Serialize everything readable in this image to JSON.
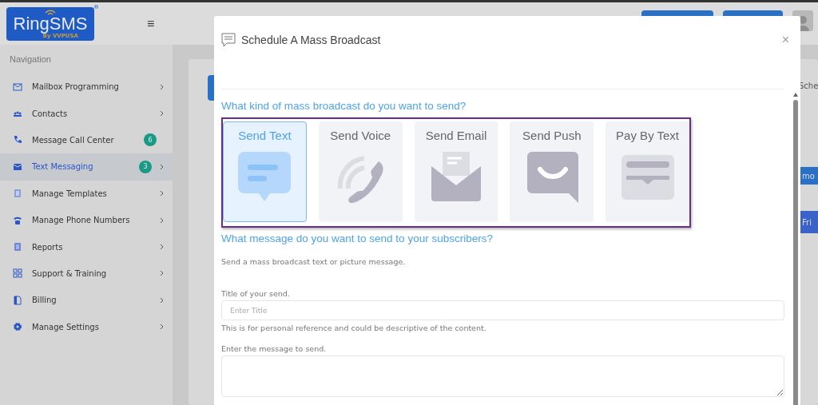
{
  "logo": {
    "name": "RingSMS",
    "tagline": "By VVPUSA",
    "mark": "®"
  },
  "menu_button": {
    "label": "≡"
  },
  "sidebar": {
    "heading": "Navigation",
    "items": [
      {
        "label": "Mailbox Programming",
        "selected": false,
        "expandable": true
      },
      {
        "label": "Contacts",
        "selected": false,
        "expandable": true
      },
      {
        "label": "Message Call Center",
        "selected": false,
        "badge": "6",
        "expandable": false
      },
      {
        "label": "Text Messaging",
        "selected": true,
        "badge": "3",
        "expandable": true
      },
      {
        "label": "Manage Templates",
        "selected": false,
        "expandable": true
      },
      {
        "label": "Manage Phone Numbers",
        "selected": false,
        "expandable": true
      },
      {
        "label": "Reports",
        "selected": false,
        "expandable": true
      },
      {
        "label": "Support & Training",
        "selected": false,
        "expandable": true
      },
      {
        "label": "Billing",
        "selected": false,
        "expandable": true
      },
      {
        "label": "Manage Settings",
        "selected": false,
        "expandable": true
      }
    ]
  },
  "background": {
    "tab_text": "Sche",
    "button_text": "mo",
    "day_text": "Fri"
  },
  "modal": {
    "title": "Schedule A Mass Broadcast",
    "close": "×",
    "kind_heading": "What kind of mass broadcast do you want to send?",
    "options": [
      {
        "label": "Send Text",
        "kind": "text",
        "selected": true
      },
      {
        "label": "Send Voice",
        "kind": "voice",
        "selected": false
      },
      {
        "label": "Send Email",
        "kind": "email",
        "selected": false
      },
      {
        "label": "Send Push",
        "kind": "push",
        "selected": false
      },
      {
        "label": "Pay By Text",
        "kind": "pay",
        "selected": false
      }
    ],
    "message_heading": "What message do you want to send to your subscribers?",
    "description": "Send a mass broadcast text or picture message.",
    "title_label": "Title of your send.",
    "title_placeholder": "Enter Title",
    "title_help": "This is for personal reference and could be descriptive of the content.",
    "message_label": "Enter the message to send."
  }
}
